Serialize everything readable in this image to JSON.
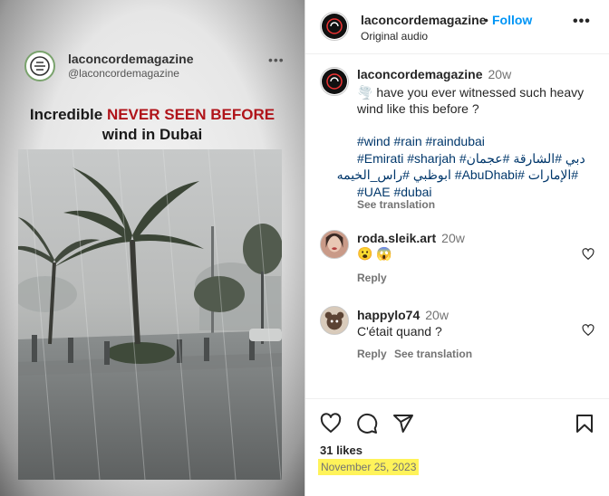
{
  "media": {
    "account_name": "laconcordemagazine",
    "handle": "@laconcordemagazine",
    "headline_black": "Incredible ",
    "headline_red": "NEVER SEEN BEFORE",
    "headline_line2": "wind in Dubai",
    "more_icon": "ellipsis-icon"
  },
  "header": {
    "username": "laconcordemagazine",
    "separator": "•",
    "follow_label": "Follow",
    "subtitle": "Original audio",
    "more_icon": "ellipsis-icon"
  },
  "caption": {
    "username": "laconcordemagazine",
    "time": "20w",
    "text": "🌪️ have you ever witnessed such heavy wind like this before ?",
    "hashtag_lines": [
      "#wind #rain #raindubai",
      "#Emirati #sharjah #دبي #الشارقة #عجمان",
      "#الإمارات #AbuDhabi# ابوظبي #راس_الخيمه",
      "#UAE #dubai"
    ],
    "see_translation": "See translation"
  },
  "comments": [
    {
      "username": "roda.sleik.art",
      "time": "20w",
      "text": "😮 😱",
      "reply": "Reply"
    },
    {
      "username": "happylo74",
      "time": "20w",
      "text": "C'était quand ?",
      "reply": "Reply",
      "see_translation": "See translation"
    }
  ],
  "actions": {
    "likes": "31 likes",
    "date": "November 25, 2023",
    "icons": [
      "heart-icon",
      "comment-icon",
      "share-icon",
      "bookmark-icon"
    ],
    "highlight_color": "#fff35a"
  },
  "colors": {
    "follow": "#0095f6",
    "hashtag": "#00376b",
    "muted": "#737373",
    "headline_red": "#b0141a"
  }
}
